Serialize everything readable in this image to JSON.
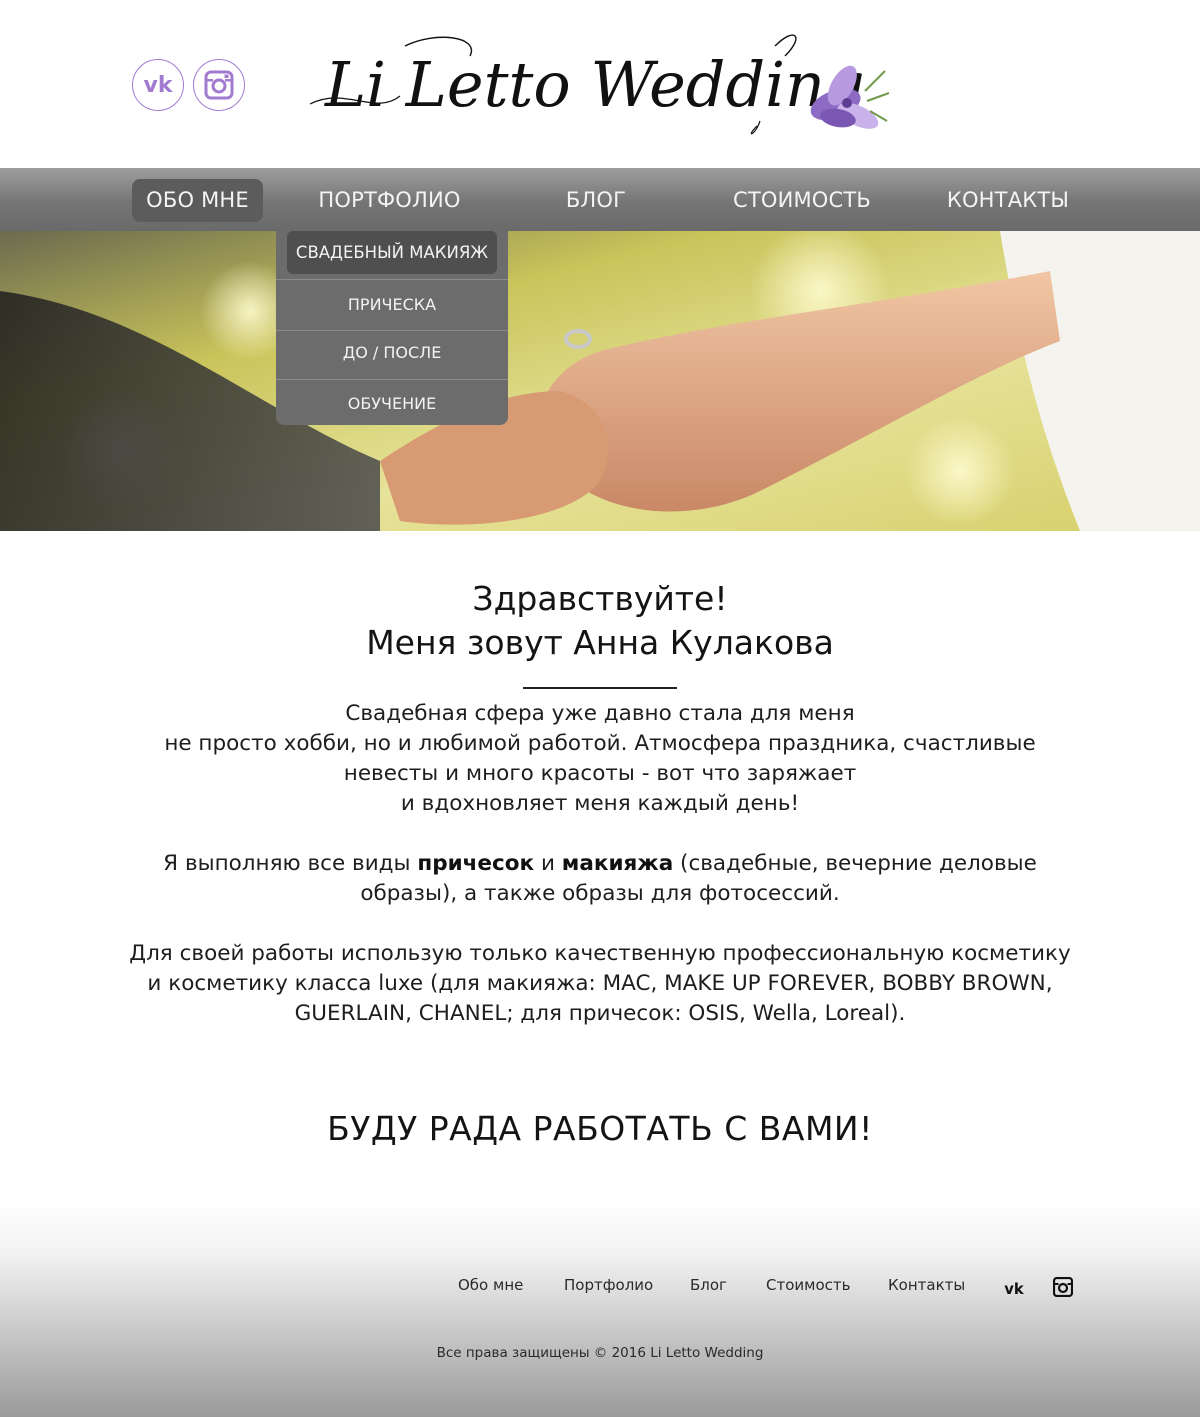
{
  "header": {
    "logo_text": "Li Letto Wedding",
    "social": [
      {
        "icon": "vk-icon"
      },
      {
        "icon": "instagram-icon"
      }
    ],
    "accent_color": "#a27bd1"
  },
  "nav": {
    "items": [
      {
        "label": "ОБО МНЕ",
        "active": true
      },
      {
        "label": "ПОРТФОЛИО"
      },
      {
        "label": "БЛОГ"
      },
      {
        "label": "СТОИМОСТЬ"
      },
      {
        "label": "КОНТАКТЫ"
      }
    ],
    "dropdown": [
      {
        "label": "СВАДЕБНЫЙ МАКИЯЖ",
        "active": true
      },
      {
        "label": "ПРИЧЕСКА"
      },
      {
        "label": "ДО / ПОСЛЕ"
      },
      {
        "label": "ОБУЧЕНИЕ"
      }
    ]
  },
  "main": {
    "greeting_line1": "Здравствуйте!",
    "greeting_line2": "Меня зовут Анна Кулакова",
    "para1": {
      "l1": "Свадебная сфера уже давно стала для меня",
      "l2": "не просто хобби, но и любимой работой. Атмосфера праздника, счастливые",
      "l3": "невесты и много красоты - вот что заряжает",
      "l4": "и вдохновляет меня каждый день!"
    },
    "para2": {
      "prefix": "Я выполняю все виды ",
      "bold1": "причесок",
      "mid": " и ",
      "bold2": "макияжа",
      "suffix": " (свадебные, вечерние деловые",
      "l2": "образы), а также образы для фотосессий."
    },
    "para3": {
      "l1": "Для своей работы использую только качественную профессиональную косметику",
      "l2": "и косметику класса luxe (для макияжа: MAC, MAKE UP FOREVER, BOBBY BROWN,",
      "l3": "GUERLAIN, CHANEL; для причесок: OSIS, Wella, Loreal)."
    },
    "cta": "БУДУ РАДА РАБОТАТЬ С ВАМИ!"
  },
  "footer": {
    "links": [
      "Обо мне",
      "Портфолио",
      "Блог",
      "Стоимость",
      "Контакты"
    ],
    "icons": [
      "vk-icon",
      "instagram-icon"
    ],
    "copyright": "Все права защищены © 2016 Li Letto Wedding"
  }
}
